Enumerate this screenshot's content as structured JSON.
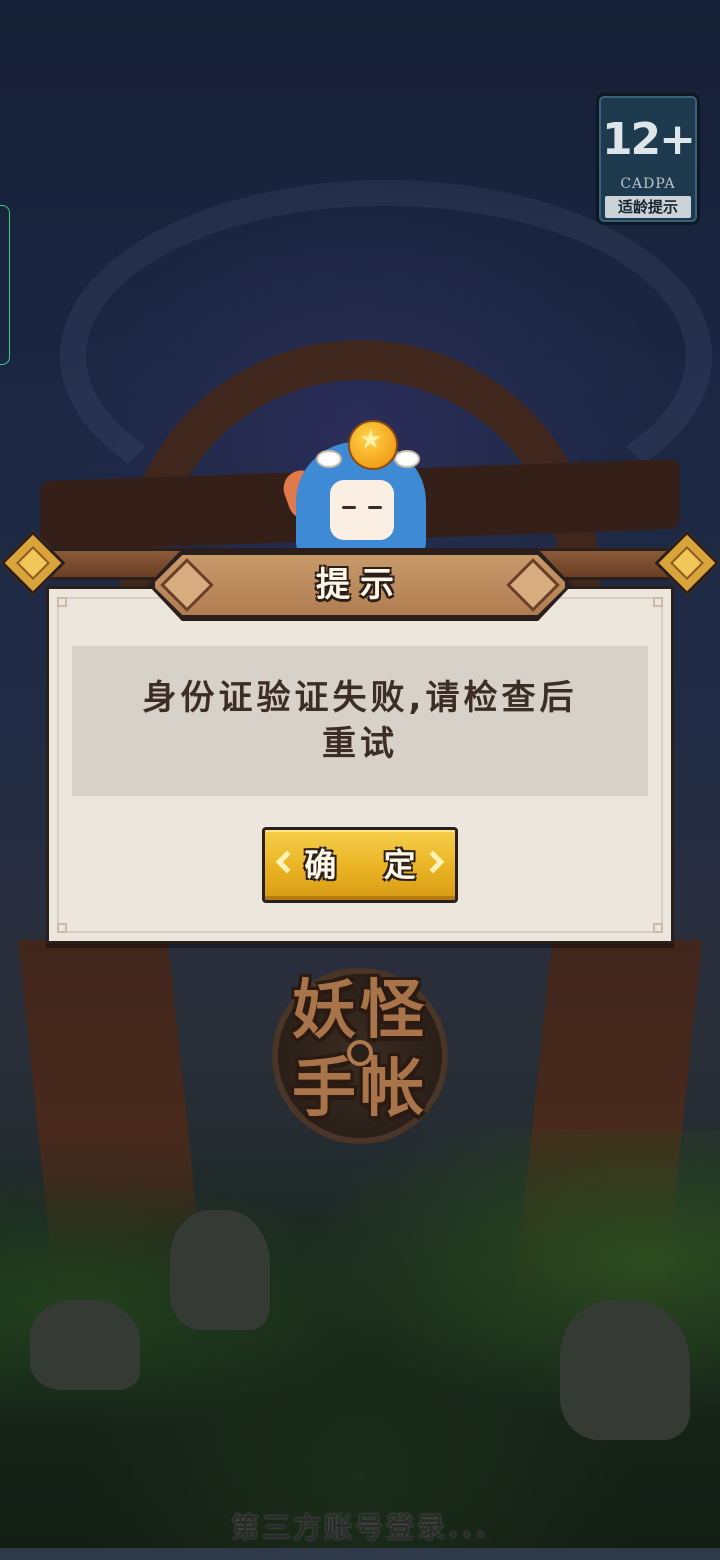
{
  "age_rating": {
    "number": "12+",
    "org": "CADPA",
    "tip": "适龄提示"
  },
  "dialog": {
    "title": "提示",
    "message": "身份证验证失败,请检查后重试",
    "confirm_label": "确 定"
  },
  "logo": {
    "line1": "妖怪",
    "line2": "手帐"
  },
  "status": {
    "login_text": "第三方账号登录..."
  },
  "colors": {
    "dialog_bg": "#ede6dc",
    "message_bg": "#d8d1c9",
    "button_gold": "#e9b323",
    "title_plate": "#b07d52",
    "outline": "#2a1f1a"
  }
}
